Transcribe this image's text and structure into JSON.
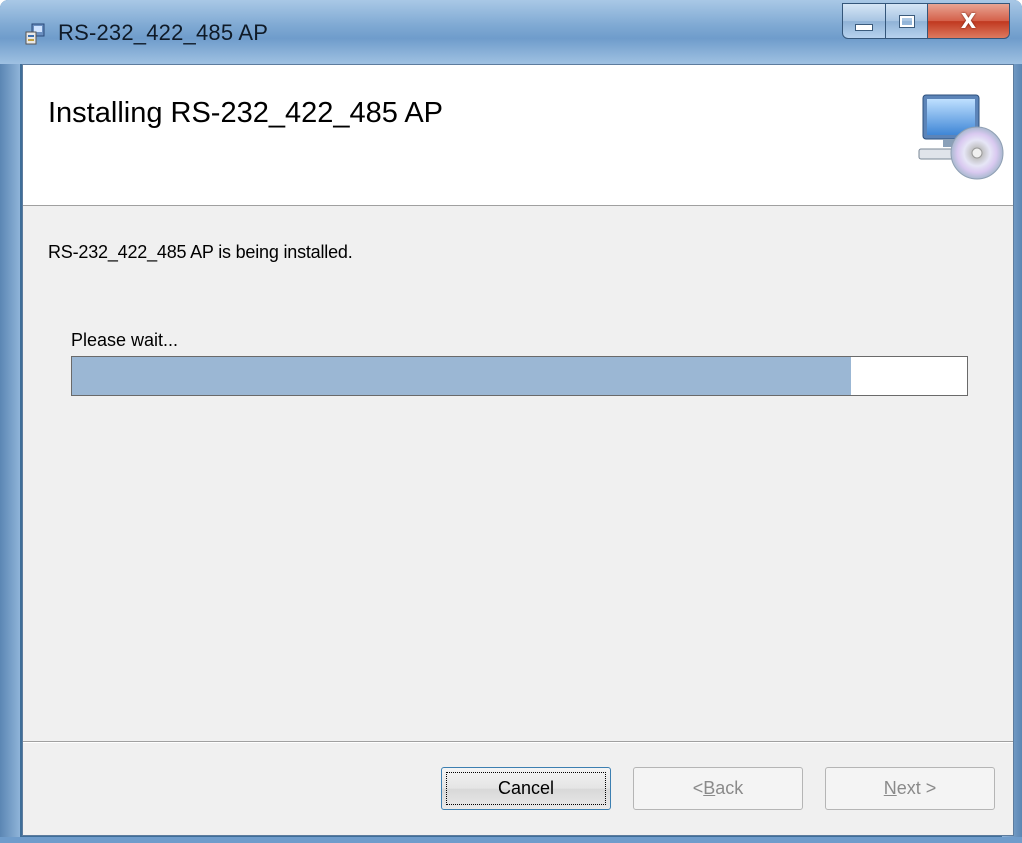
{
  "window": {
    "title": "RS-232_422_485 AP",
    "close_glyph": "X"
  },
  "banner": {
    "title": "Installing RS-232_422_485 AP",
    "icon": "computer-cd-icon"
  },
  "main": {
    "status_text": "RS-232_422_485 AP is being installed.",
    "wait_label": "Please wait...",
    "progress_fraction": 0.87
  },
  "buttons": {
    "cancel": "Cancel",
    "back_prefix": "< ",
    "back_mnemonic": "B",
    "back_rest": "ack",
    "next_mnemonic": "N",
    "next_rest": "ext >"
  },
  "colors": {
    "progress_fill": "#9bb7d4",
    "client_bg": "#f0f0f0",
    "close_button": "#c0381f"
  }
}
